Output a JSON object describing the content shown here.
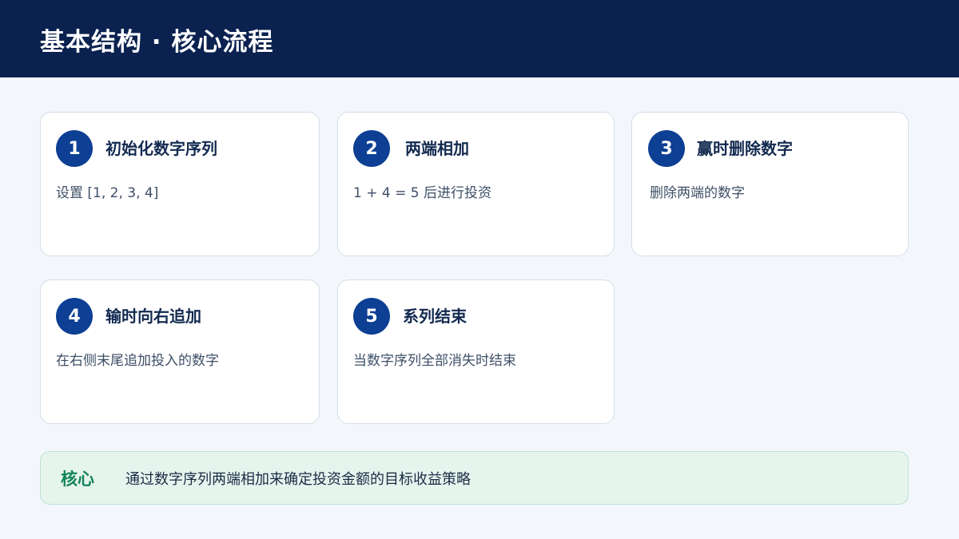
{
  "header": {
    "title": "基本结构 · 核心流程"
  },
  "colors": {
    "header_bg": "#0b2250",
    "badge_bg": "#0d3f94",
    "core_accent": "#13845b",
    "core_bg": "#e6f4ee"
  },
  "steps": [
    {
      "number": "1",
      "title": "初始化数字序列",
      "desc": "设置 [1, 2, 3, 4]"
    },
    {
      "number": "2",
      "title": "两端相加",
      "desc": "1 + 4 = 5 后进行投资"
    },
    {
      "number": "3",
      "title": "赢时删除数字",
      "desc": "删除两端的数字"
    },
    {
      "number": "4",
      "title": "输时向右追加",
      "desc": "在右侧末尾追加投入的数字"
    },
    {
      "number": "5",
      "title": "系列结束",
      "desc": "当数字序列全部消失时结束"
    }
  ],
  "core": {
    "label": "核心",
    "text": "通过数字序列两端相加来确定投资金额的目标收益策略"
  }
}
